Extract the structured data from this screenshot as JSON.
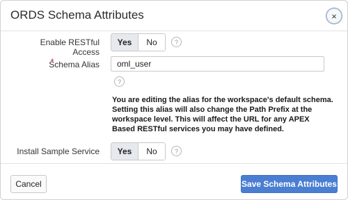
{
  "dialog": {
    "title": "ORDS Schema Attributes",
    "close_glyph": "×",
    "close_icon": "close-icon"
  },
  "form": {
    "enable_restful": {
      "label": "Enable RESTful Access",
      "options": [
        "Yes",
        "No"
      ],
      "selected": "Yes",
      "help_glyph": "?"
    },
    "schema_alias": {
      "label": "Schema Alias",
      "required_mark": "*",
      "value": "oml_user",
      "help_glyph": "?"
    },
    "note": "You are editing the alias for the workspace's default schema. Setting this alias will also change the Path Prefix at the workspace level. This will affect the URL for any APEX Based RESTful services you may have defined.",
    "install_sample": {
      "label": "Install Sample Service",
      "options": [
        "Yes",
        "No"
      ],
      "selected": "Yes",
      "help_glyph": "?"
    }
  },
  "footer": {
    "cancel_label": "Cancel",
    "save_label": "Save Schema Attributes"
  },
  "colors": {
    "primary": "#4a7ed1",
    "required": "#d0021b",
    "toggle_selected": "#e6e9ee"
  }
}
